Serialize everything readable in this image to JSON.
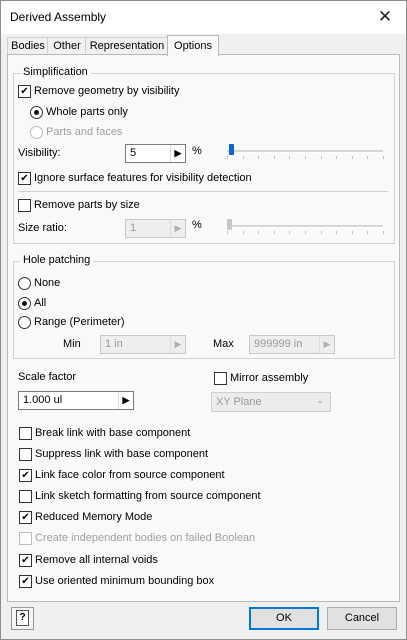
{
  "window": {
    "title": "Derived Assembly",
    "close_glyph": "✕"
  },
  "tabs": [
    "Bodies",
    "Other",
    "Representation",
    "Options"
  ],
  "simplification": {
    "legend": "Simplification",
    "remove_by_visibility": {
      "label": "Remove geometry by visibility",
      "checked": true
    },
    "whole_parts_only": {
      "label": "Whole parts only",
      "selected": true
    },
    "parts_and_faces": {
      "label": "Parts and faces",
      "selected": false
    },
    "visibility": {
      "label": "Visibility:",
      "value": "5",
      "unit": "%",
      "slider_level": 0.03
    },
    "ignore_surface": {
      "label": "Ignore surface features for visibility detection",
      "checked": true
    },
    "remove_by_size": {
      "label": "Remove parts by size",
      "checked": false
    },
    "size_ratio": {
      "label": "Size ratio:",
      "value": "1",
      "unit": "%",
      "slider_level": 0
    }
  },
  "hole_patching": {
    "legend": "Hole patching",
    "none": {
      "label": "None",
      "selected": false
    },
    "all": {
      "label": "All",
      "selected": true
    },
    "range": {
      "label": "Range (Perimeter)",
      "selected": false
    },
    "min_label": "Min",
    "min_value": "1 in",
    "max_label": "Max",
    "max_value": "999999 in"
  },
  "scale": {
    "label": "Scale factor",
    "value": "1.000 ul"
  },
  "mirror": {
    "label": "Mirror assembly",
    "checked": false,
    "plane": "XY Plane"
  },
  "options": [
    {
      "label": "Break link with base component",
      "checked": false,
      "enabled": true
    },
    {
      "label": "Suppress link with base component",
      "checked": false,
      "enabled": true
    },
    {
      "label": "Link face color from source component",
      "checked": true,
      "enabled": true
    },
    {
      "label": "Link sketch formatting from source component",
      "checked": false,
      "enabled": true
    },
    {
      "label": "Reduced Memory Mode",
      "checked": true,
      "enabled": true
    },
    {
      "label": "Create independent bodies on failed Boolean",
      "checked": false,
      "enabled": false
    },
    {
      "label": "Remove all internal voids",
      "checked": true,
      "enabled": true
    },
    {
      "label": "Use oriented minimum bounding box",
      "checked": true,
      "enabled": true
    }
  ],
  "footer": {
    "help_glyph": "?",
    "ok": "OK",
    "cancel": "Cancel"
  },
  "glyphs": {
    "check": "✔",
    "arrow_right": "▶",
    "chevron_down": "⌄"
  },
  "colors": {
    "accent": "#0078d7",
    "slider_thumb": "#0a64d6"
  }
}
